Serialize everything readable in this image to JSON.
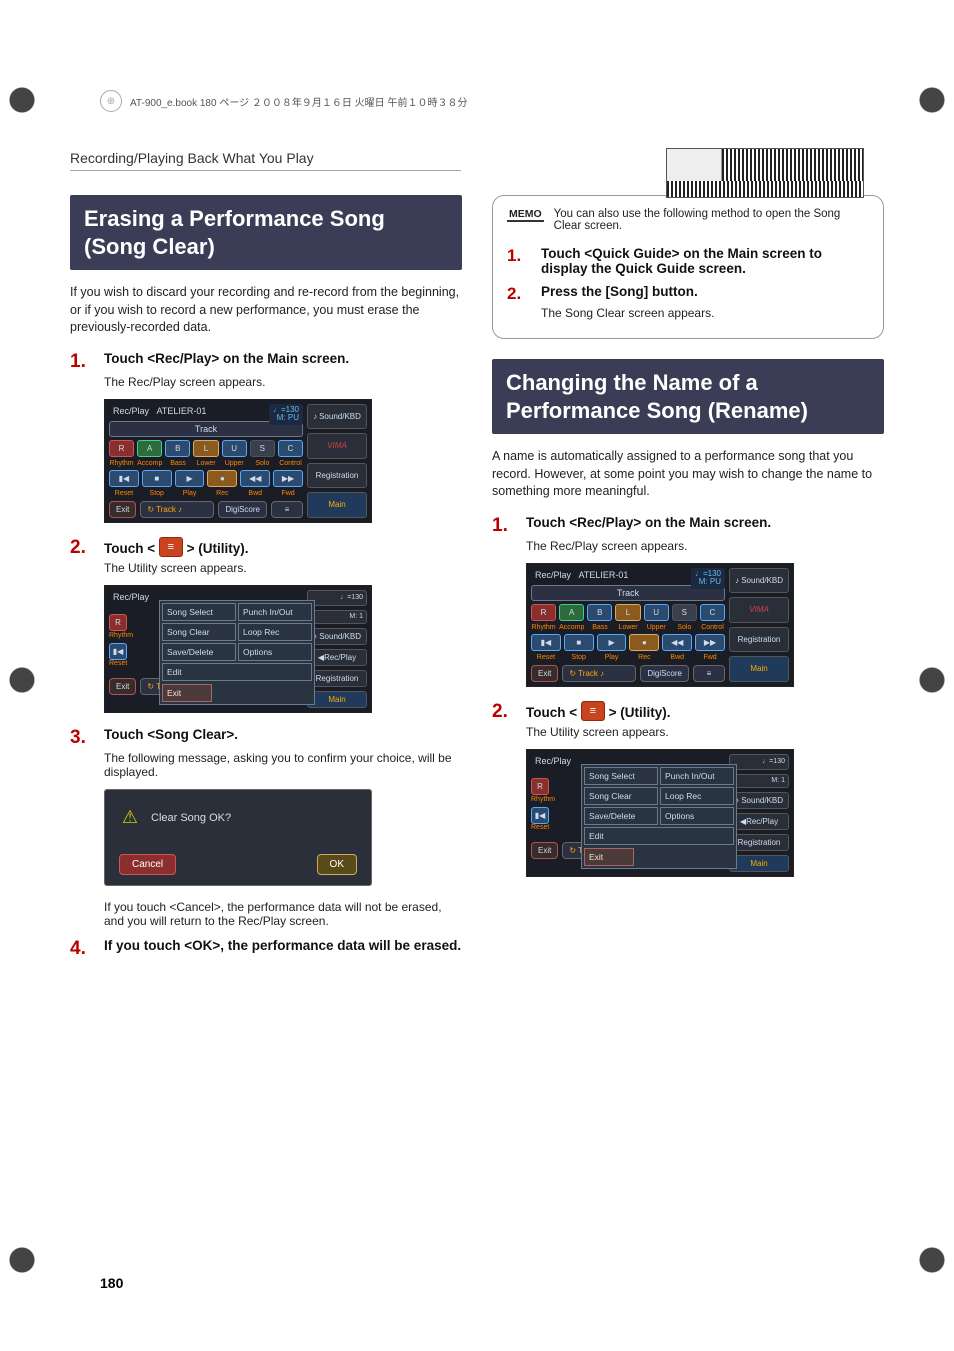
{
  "topbar": "AT-900_e.book  180 ページ  ２００８年９月１６日  火曜日  午前１０時３８分",
  "breadcrumb": "Recording/Playing Back What You Play",
  "left": {
    "heading": "Erasing a Performance Song (Song Clear)",
    "intro": "If you wish to discard your recording and re-record from the beginning, or if you wish to record a new performance, you must erase the previously-recorded data.",
    "s1t": "Touch <Rec/Play> on the Main screen.",
    "s1sub": "The Rec/Play screen appears.",
    "s2pre": "Touch < ",
    "s2post": " > (Utility).",
    "s2sub": "The Utility screen appears.",
    "s3t": "Touch <Song Clear>.",
    "s3sub": "The following message, asking you to confirm your choice, will be displayed.",
    "confirmQ": "Clear Song OK?",
    "cancel": "Cancel",
    "ok": "OK",
    "afterCancel": "If you touch <Cancel>, the performance data will not be erased, and you will return to the Rec/Play screen.",
    "s4t": "If you touch <OK>, the performance data will be erased."
  },
  "right": {
    "memo": "You can also use the following method to open the Song Clear screen.",
    "memoTag": "MEMO",
    "m1": "Touch <Quick Guide> on the Main screen to display the Quick Guide screen.",
    "m2": "Press the [Song] button.",
    "m2sub": "The Song Clear screen appears.",
    "heading": "Changing the Name of a Performance Song (Rename)",
    "intro": "A name is automatically assigned to a performance song that you record. However, at some point you may wish to change the name to something more meaningful.",
    "s1t": "Touch <Rec/Play> on the Main screen.",
    "s1sub": "The Rec/Play screen appears.",
    "s2pre": "Touch < ",
    "s2post": " > (Utility).",
    "s2sub": "The Utility screen appears."
  },
  "ss": {
    "recplay": "Rec/Play",
    "songname": "ATELIER-01",
    "tempo": "♩=130",
    "meas": "M:  PU",
    "meas1": "M:    1",
    "track": "Track",
    "r": "R",
    "a": "A",
    "b": "B",
    "l": "L",
    "u": "U",
    "s": "S",
    "c": "C",
    "lr": "Rhythm",
    "la": "Accomp",
    "lb": "Bass",
    "ll": "Lower",
    "lu": "Upper",
    "ls": "Solo",
    "lc": "Control",
    "reset": "Reset",
    "stop": "Stop",
    "play": "Play",
    "rec": "Rec",
    "bwd": "Bwd",
    "fwd": "Fwd",
    "soundkbd": "Sound/KBD",
    "vima": "VIMA",
    "registration": "Registration",
    "main": "Main",
    "recplaySide": "Rec/Play",
    "exit": "Exit",
    "trackBtn": "Track",
    "digi": "DigiScore",
    "dp1": "Song Select",
    "dp2": "Punch In/Out",
    "dp3": "Song Clear",
    "dp4": "Loop Rec",
    "dp5": "Save/Delete",
    "dp6": "Options",
    "dp7": "Edit",
    "dpExit": "Exit"
  },
  "pageNum": "180"
}
